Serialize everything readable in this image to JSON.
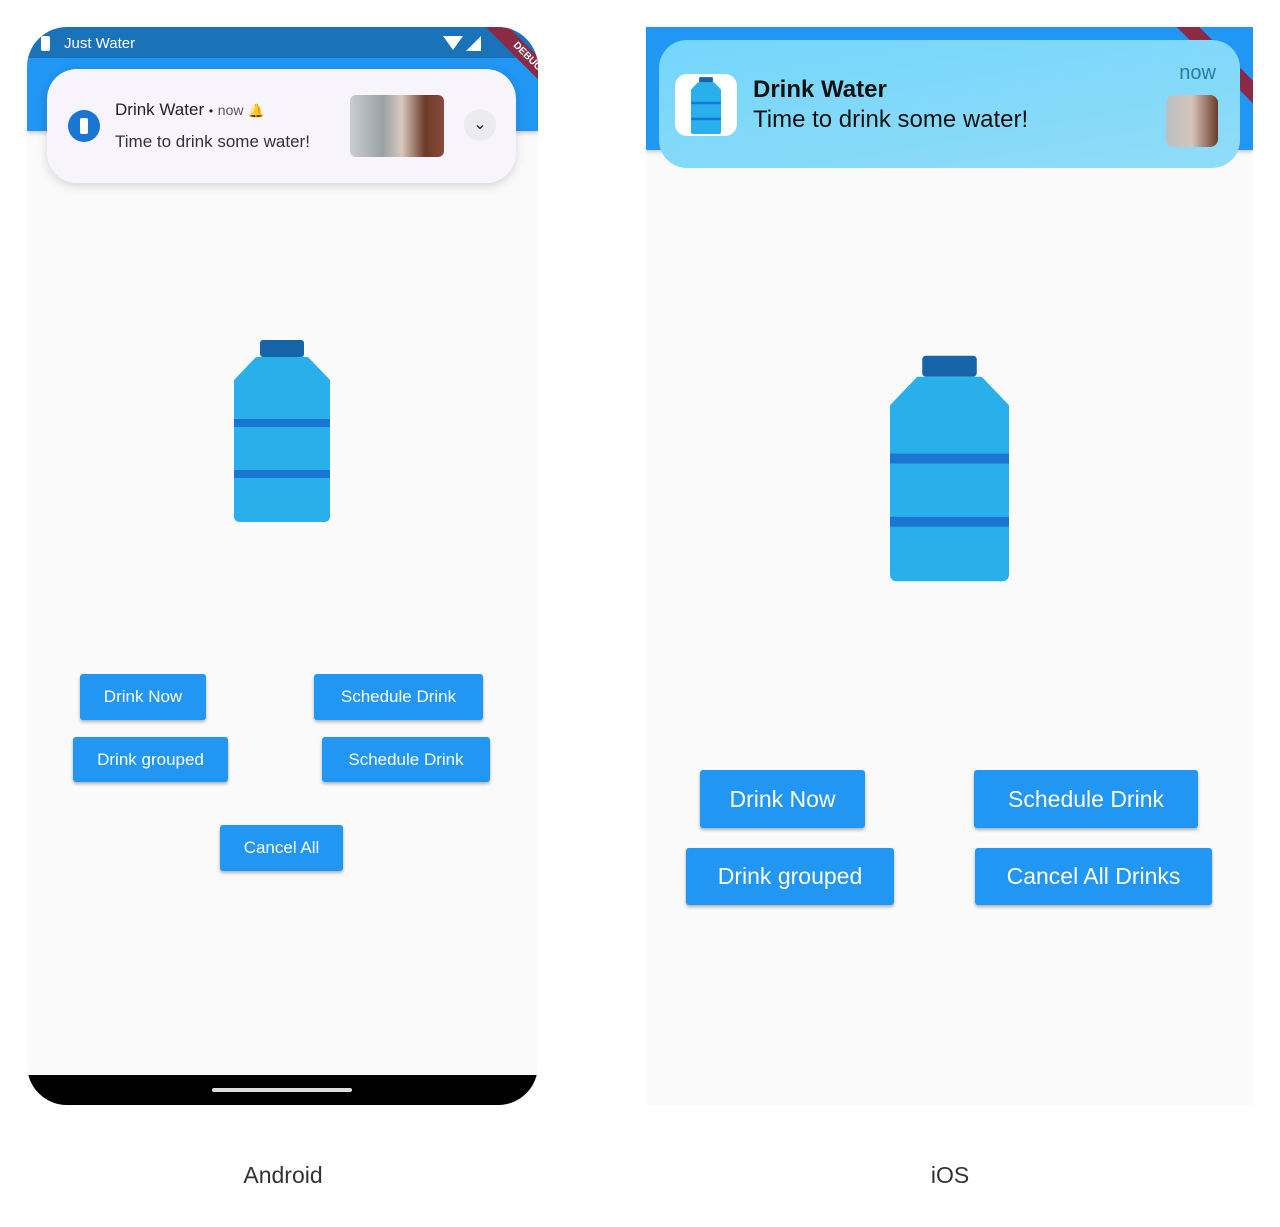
{
  "android": {
    "status_bar": {
      "app_name": "Just Water"
    },
    "debug_banner": "DEBUG",
    "notification": {
      "title": "Drink Water",
      "separator": "•",
      "time": "now",
      "body": "Time to drink some water!"
    },
    "buttons": {
      "drink_now": "Drink Now",
      "schedule_drink": "Schedule Drink",
      "drink_grouped": "Drink grouped",
      "schedule_drink_2": "Schedule Drink",
      "cancel_all": "Cancel All"
    },
    "caption": "Android"
  },
  "ios": {
    "notification": {
      "title": "Drink Water",
      "body": "Time to drink some water!",
      "time": "now"
    },
    "buttons": {
      "drink_now": "Drink Now",
      "schedule_drink": "Schedule Drink",
      "drink_grouped": "Drink grouped",
      "cancel_all": "Cancel All Drinks"
    },
    "caption": "iOS"
  },
  "colors": {
    "primary": "#2196f3",
    "status_bar": "#1a72b8",
    "bottle": "#29b6f6",
    "bottle_cap": "#1565a8",
    "debug": "#8b2a45"
  }
}
